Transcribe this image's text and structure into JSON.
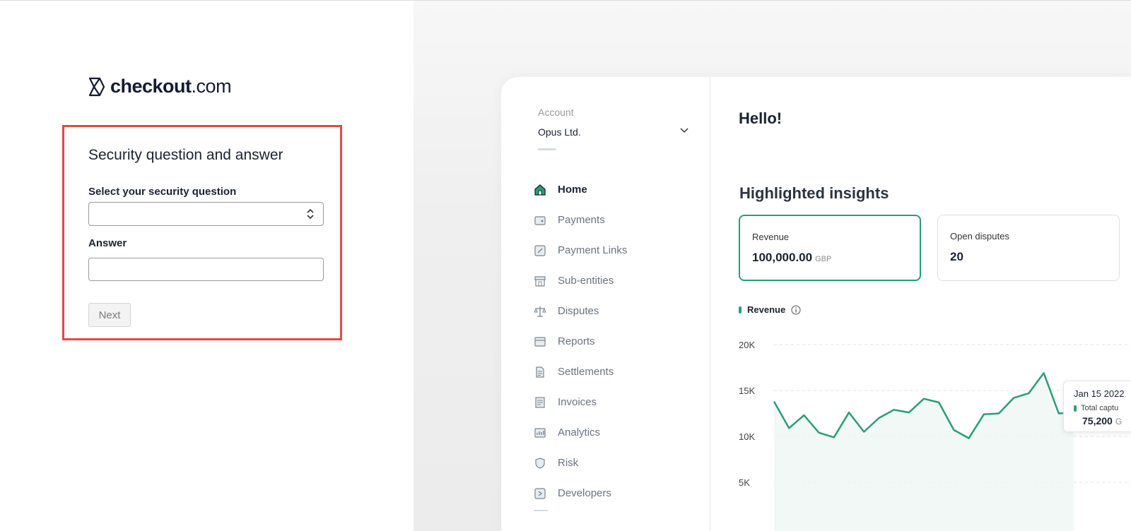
{
  "logo": {
    "text_bold": "checkout",
    "text_light": ".com"
  },
  "form": {
    "title": "Security question and answer",
    "question_label": "Select your security question",
    "question_value": "",
    "answer_label": "Answer",
    "answer_value": "",
    "next_label": "Next"
  },
  "dashboard": {
    "account_label": "Account",
    "account_name": "Opus Ltd.",
    "nav": [
      {
        "label": "Home",
        "icon": "home-icon",
        "active": true
      },
      {
        "label": "Payments",
        "icon": "wallet-icon"
      },
      {
        "label": "Payment Links",
        "icon": "link-icon"
      },
      {
        "label": "Sub-entities",
        "icon": "store-icon"
      },
      {
        "label": "Disputes",
        "icon": "scales-icon"
      },
      {
        "label": "Reports",
        "icon": "report-icon"
      },
      {
        "label": "Settlements",
        "icon": "document-icon"
      },
      {
        "label": "Invoices",
        "icon": "invoice-icon"
      },
      {
        "label": "Analytics",
        "icon": "analytics-icon"
      },
      {
        "label": "Risk",
        "icon": "shield-icon"
      },
      {
        "label": "Developers",
        "icon": "code-icon"
      }
    ],
    "greeting": "Hello!",
    "insights_title": "Highlighted insights",
    "cards": [
      {
        "label": "Revenue",
        "value": "100,000.00",
        "unit": "GBP"
      },
      {
        "label": "Open disputes",
        "value": "20",
        "unit": ""
      }
    ],
    "legend_label": "Revenue",
    "tooltip": {
      "date": "Jan 15 2022",
      "label": "Total captu",
      "value": "75,200",
      "unit": "G"
    }
  },
  "colors": {
    "accent": "#2a9d78",
    "highlight": "#e04b44"
  },
  "chart_data": {
    "type": "area",
    "y_ticks": [
      "20K",
      "15K",
      "10K",
      "5K"
    ],
    "ylim": [
      5000,
      20000
    ],
    "series": [
      {
        "name": "Revenue",
        "values": [
          13800,
          10900,
          12300,
          10400,
          9900,
          12600,
          10500,
          12000,
          12900,
          12600,
          14100,
          13700,
          10700,
          9800,
          12400,
          12500,
          14200,
          14700,
          16900,
          12500,
          12600
        ]
      }
    ]
  }
}
